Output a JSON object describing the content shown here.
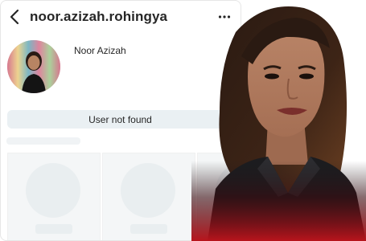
{
  "header": {
    "back_icon": "chevron-left-icon",
    "username": "noor.azizah.rohingya",
    "more_icon": "ellipsis-icon"
  },
  "profile": {
    "display_name": "Noor Azizah"
  },
  "status": {
    "message": "User not found"
  },
  "colors": {
    "text": "#262626",
    "notfound_bg": "#eaf0f3",
    "placeholder": "#f4f6f7",
    "accent_red": "#b8141c"
  }
}
